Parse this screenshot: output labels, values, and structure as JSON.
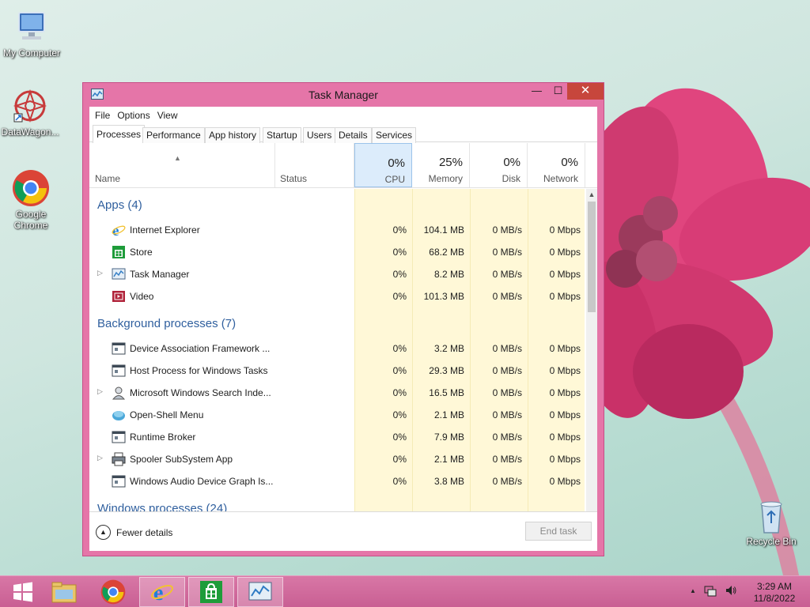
{
  "desktop": {
    "icons": [
      {
        "label": "My Computer"
      },
      {
        "label": "DataWagon..."
      },
      {
        "label": "Google Chrome"
      },
      {
        "label": "Recycle Bin"
      }
    ]
  },
  "window": {
    "title": "Task Manager",
    "buttons": {
      "minimize": "—",
      "maximize": "☐",
      "close": "✕"
    },
    "menu": [
      "File",
      "Options",
      "View"
    ],
    "tabs": [
      "Processes",
      "Performance",
      "App history",
      "Startup",
      "Users",
      "Details",
      "Services"
    ],
    "active_tab": "Processes",
    "columns": {
      "name": "Name",
      "status": "Status",
      "cpu": {
        "pct": "0%",
        "label": "CPU"
      },
      "memory": {
        "pct": "25%",
        "label": "Memory"
      },
      "disk": {
        "pct": "0%",
        "label": "Disk"
      },
      "network": {
        "pct": "0%",
        "label": "Network"
      }
    },
    "groups": {
      "apps": "Apps (4)",
      "background": "Background processes (7)",
      "windows": "Windows processes (24)"
    },
    "apps": [
      {
        "name": "Internet Explorer",
        "icon": "ie-icon",
        "cpu": "0%",
        "mem": "104.1 MB",
        "disk": "0 MB/s",
        "net": "0 Mbps",
        "expandable": false
      },
      {
        "name": "Store",
        "icon": "store-icon",
        "cpu": "0%",
        "mem": "68.2 MB",
        "disk": "0 MB/s",
        "net": "0 Mbps",
        "expandable": false
      },
      {
        "name": "Task Manager",
        "icon": "taskmgr-icon",
        "cpu": "0%",
        "mem": "8.2 MB",
        "disk": "0 MB/s",
        "net": "0 Mbps",
        "expandable": true
      },
      {
        "name": "Video",
        "icon": "video-icon",
        "cpu": "0%",
        "mem": "101.3 MB",
        "disk": "0 MB/s",
        "net": "0 Mbps",
        "expandable": false
      }
    ],
    "background": [
      {
        "name": "Device Association Framework ...",
        "icon": "service-icon",
        "cpu": "0%",
        "mem": "3.2 MB",
        "disk": "0 MB/s",
        "net": "0 Mbps",
        "expandable": false
      },
      {
        "name": "Host Process for Windows Tasks",
        "icon": "service-icon",
        "cpu": "0%",
        "mem": "29.3 MB",
        "disk": "0 MB/s",
        "net": "0 Mbps",
        "expandable": false
      },
      {
        "name": "Microsoft Windows Search Inde...",
        "icon": "search-indexer-icon",
        "cpu": "0%",
        "mem": "16.5 MB",
        "disk": "0 MB/s",
        "net": "0 Mbps",
        "expandable": true
      },
      {
        "name": "Open-Shell Menu",
        "icon": "shell-icon",
        "cpu": "0%",
        "mem": "2.1 MB",
        "disk": "0 MB/s",
        "net": "0 Mbps",
        "expandable": false
      },
      {
        "name": "Runtime Broker",
        "icon": "service-icon",
        "cpu": "0%",
        "mem": "7.9 MB",
        "disk": "0 MB/s",
        "net": "0 Mbps",
        "expandable": false
      },
      {
        "name": "Spooler SubSystem App",
        "icon": "printer-icon",
        "cpu": "0%",
        "mem": "2.1 MB",
        "disk": "0 MB/s",
        "net": "0 Mbps",
        "expandable": true
      },
      {
        "name": "Windows Audio Device Graph Is...",
        "icon": "service-icon",
        "cpu": "0%",
        "mem": "3.8 MB",
        "disk": "0 MB/s",
        "net": "0 Mbps",
        "expandable": false
      }
    ],
    "footer": {
      "fewer_details": "Fewer details",
      "end_task": "End task"
    }
  },
  "taskbar": {
    "items": [
      "start-button",
      "file-explorer",
      "chrome",
      "internet-explorer",
      "store",
      "task-manager"
    ],
    "clock": {
      "time": "3:29 AM",
      "date": "11/8/2022"
    },
    "tray_arrow": "▲"
  },
  "colors": {
    "window_frame": "#e575a8",
    "close_button": "#c7463c",
    "group_header": "#2f5f9e",
    "heat_cell": "#fff8d7",
    "cpu_header": "#dcecfb"
  }
}
